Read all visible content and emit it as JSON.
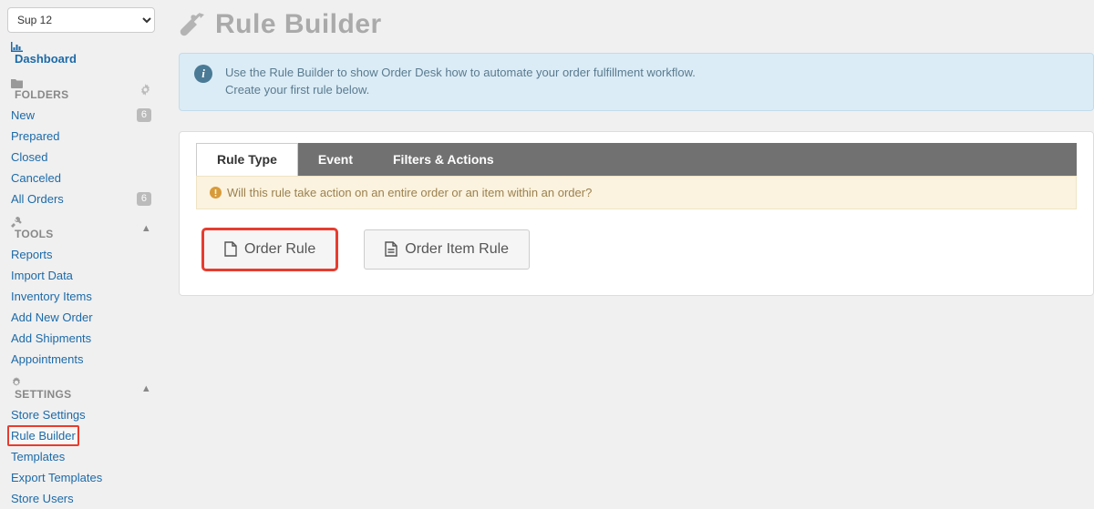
{
  "sidebar": {
    "store_selector": "Sup 12",
    "dashboard_label": "Dashboard",
    "folders": {
      "title": "FOLDERS",
      "items": [
        {
          "label": "New",
          "badge": "6"
        },
        {
          "label": "Prepared",
          "badge": ""
        },
        {
          "label": "Closed",
          "badge": ""
        },
        {
          "label": "Canceled",
          "badge": ""
        },
        {
          "label": "All Orders",
          "badge": "6"
        }
      ]
    },
    "tools": {
      "title": "TOOLS",
      "items": [
        {
          "label": "Reports"
        },
        {
          "label": "Import Data"
        },
        {
          "label": "Inventory Items"
        },
        {
          "label": "Add New Order"
        },
        {
          "label": "Add Shipments"
        },
        {
          "label": "Appointments"
        }
      ]
    },
    "settings": {
      "title": "SETTINGS",
      "items": [
        {
          "label": "Store Settings"
        },
        {
          "label": "Rule Builder"
        },
        {
          "label": "Templates"
        },
        {
          "label": "Export Templates"
        },
        {
          "label": "Store Users"
        }
      ]
    }
  },
  "page": {
    "title": "Rule Builder",
    "info_line1": "Use the Rule Builder to show Order Desk how to automate your order fulfillment workflow.",
    "info_line2": "Create your first rule below."
  },
  "panel": {
    "tabs": {
      "rule_type": "Rule Type",
      "event": "Event",
      "filters_actions": "Filters & Actions"
    },
    "hint": "Will this rule take action on an entire order or an item within an order?",
    "buttons": {
      "order_rule": "Order Rule",
      "order_item_rule": "Order Item Rule"
    }
  }
}
